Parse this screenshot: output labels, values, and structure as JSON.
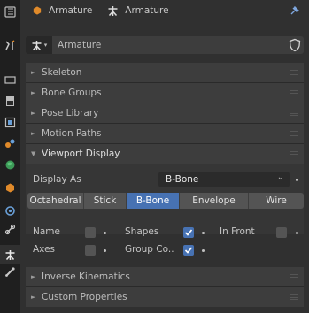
{
  "header": {
    "object_name": "Armature",
    "data_name": "Armature"
  },
  "datablock": {
    "name": "Armature"
  },
  "panels": {
    "skeleton": "Skeleton",
    "bone_groups": "Bone Groups",
    "pose_library": "Pose Library",
    "motion_paths": "Motion Paths",
    "viewport_display": "Viewport Display",
    "inverse_kinematics": "Inverse Kinematics",
    "custom_properties": "Custom Properties"
  },
  "viewport_display": {
    "display_as_label": "Display As",
    "display_as_value": "B-Bone",
    "display_options": [
      "Octahedral",
      "Stick",
      "B-Bone",
      "Envelope",
      "Wire"
    ],
    "selected_option": "B-Bone",
    "name_label": "Name",
    "name_checked": false,
    "shapes_label": "Shapes",
    "shapes_checked": true,
    "in_front_label": "In Front",
    "in_front_checked": false,
    "axes_label": "Axes",
    "axes_checked": false,
    "group_colors_label": "Group Co..",
    "group_colors_checked": true
  },
  "colors": {
    "accent": "#4772b3",
    "panel_bg": "#3d3d3d",
    "editor_bg": "#303030",
    "tabs_bg": "#1f1f1f",
    "object_orange": "#e08a2a",
    "pin_blue": "#7ea6dd"
  },
  "icons": {
    "tabs": [
      "tool-icon",
      "render-icon",
      "output-icon",
      "view-layer-icon",
      "scene-icon",
      "world-icon",
      "object-icon",
      "modifier-icon",
      "particles-icon",
      "physics-icon",
      "constraints-icon",
      "armature-data-icon",
      "bone-icon"
    ]
  }
}
